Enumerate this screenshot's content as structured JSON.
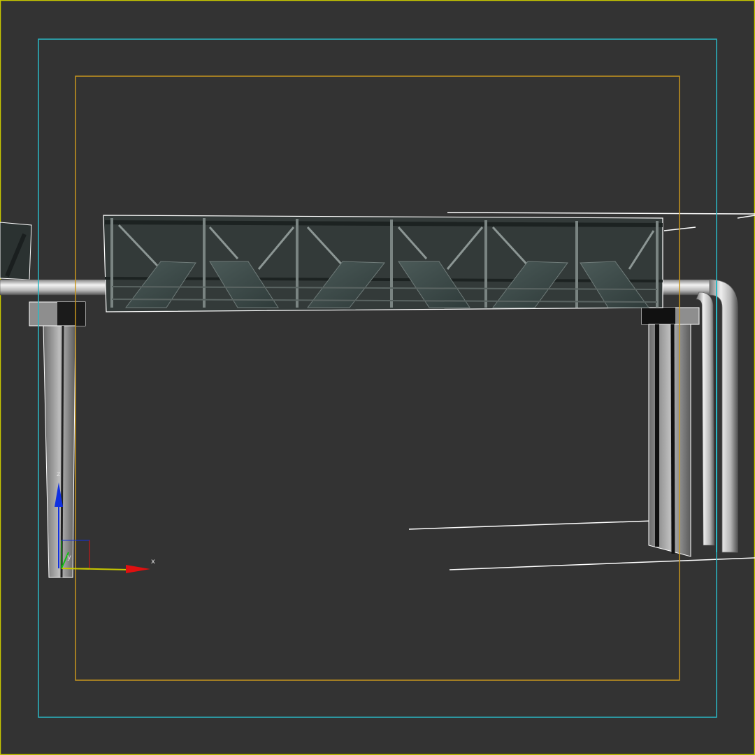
{
  "viewport": {
    "background": "#333333",
    "active_border_color": "#c8c800",
    "safe_frame_action_color": "#2ab8c4",
    "safe_frame_title_color": "#c8961e",
    "wireframe_color": "#ffffff"
  },
  "scene": {
    "model": "overhead-pipe-truss-bridge",
    "truss_color": "#3c4a48",
    "pipe_color": "#c8c8c8",
    "support_color": "#9a9a9a"
  },
  "axis_gizmo": {
    "x_label": "x",
    "y_label": "y",
    "z_label": "z",
    "x_color": "#e01010",
    "y_color": "#10c010",
    "z_color": "#1030e0"
  }
}
